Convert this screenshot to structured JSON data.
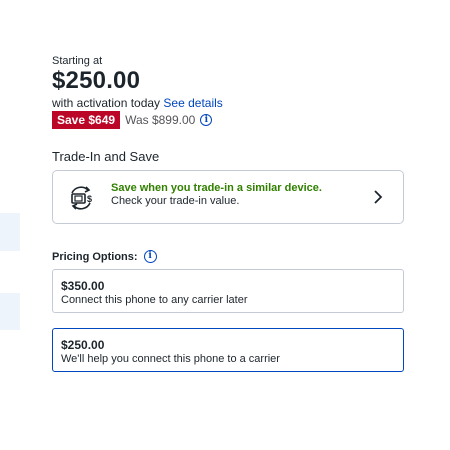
{
  "offer": {
    "starting_label": "Starting at",
    "price": "$250.00",
    "activation_text": "with activation today",
    "see_details": "See details",
    "save_badge": "Save $649",
    "was_price": "Was $899.00"
  },
  "trade_in": {
    "title": "Trade-In and Save",
    "headline": "Save when you trade-in a similar device.",
    "subtext": "Check your trade-in value."
  },
  "pricing": {
    "title": "Pricing Options:",
    "options": [
      {
        "price": "$350.00",
        "description": "Connect this phone to any carrier later",
        "selected": false
      },
      {
        "price": "$250.00",
        "description": "We'll help you connect this phone to a carrier",
        "selected": true
      }
    ]
  },
  "colors": {
    "accent": "#0046be",
    "save_red": "#bb0628",
    "trade_green": "#318000"
  },
  "icons": [
    "info-icon",
    "trade-in-device-icon",
    "chevron-right-icon"
  ]
}
